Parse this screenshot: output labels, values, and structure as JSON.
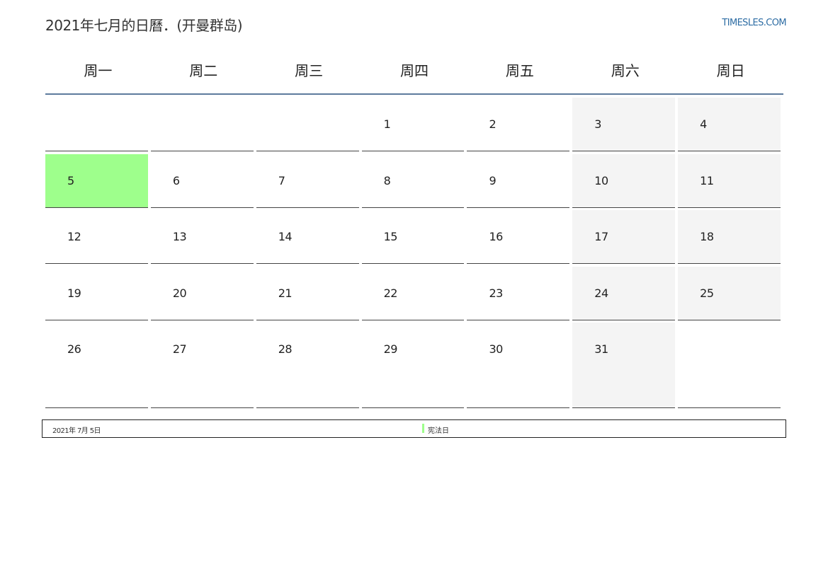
{
  "header": {
    "title": "2021年七月的日曆．(开曼群岛)",
    "site": "TIMESLES.COM"
  },
  "weekdays": [
    "周一",
    "周二",
    "周三",
    "周四",
    "周五",
    "周六",
    "周日"
  ],
  "weeks": [
    [
      "",
      "",
      "",
      "1",
      "2",
      "3",
      "4"
    ],
    [
      "5",
      "6",
      "7",
      "8",
      "9",
      "10",
      "11"
    ],
    [
      "12",
      "13",
      "14",
      "15",
      "16",
      "17",
      "18"
    ],
    [
      "19",
      "20",
      "21",
      "22",
      "23",
      "24",
      "25"
    ],
    [
      "26",
      "27",
      "28",
      "29",
      "30",
      "31",
      ""
    ]
  ],
  "holidays": [
    {
      "date": "2021年 7月 5日",
      "name": "宪法日",
      "color": "#9eff8c"
    }
  ],
  "colors": {
    "weekend": "#f4f4f4",
    "holiday": "#9eff8c",
    "header_rule": "#5d7b9d",
    "link": "#2e6da4"
  }
}
